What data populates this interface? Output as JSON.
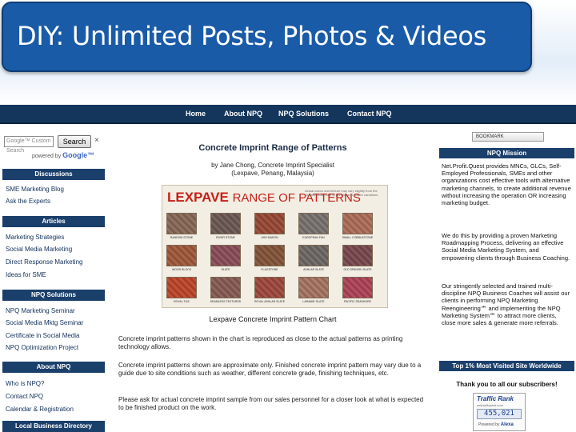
{
  "slide": {
    "title": "DIY: Unlimited Posts, Photos & Videos"
  },
  "topnav": {
    "items": [
      "Home",
      "About NPQ",
      "NPQ Solutions",
      "Contact NPQ"
    ]
  },
  "search": {
    "placeholder": "Google™ Custom Search",
    "button_label": "Search",
    "close": "×",
    "powered_by": "powered by",
    "powered_brand": "Google™"
  },
  "sidebar": {
    "sections": [
      {
        "heading": "Discussions",
        "links": [
          "SME Marketing Blog",
          "Ask the Experts"
        ]
      },
      {
        "heading": "Articles",
        "links": [
          "Marketing Strategies",
          "Social Media Marketing",
          "Direct Response Marketing",
          "Ideas for SME"
        ]
      },
      {
        "heading": "NPQ Solutions",
        "links": [
          "NPQ Marketing Seminar",
          "Social Media Mktg Seminar",
          "Certificate in Social Media",
          "NPQ Optimization Project"
        ]
      },
      {
        "heading": "About NPQ",
        "links": [
          "Who is NPQ?",
          "Contact NPQ",
          "Calendar & Registration"
        ]
      },
      {
        "heading": "Local Business Directory",
        "links": []
      }
    ]
  },
  "main": {
    "heading": "Concrete Imprint Range of Patterns",
    "byline_1": "by Jane Chong, Concrete Imprint Specialist",
    "byline_2": "(Lexpave, Penang, Malaysia)",
    "chart_brand": "LEXPAVE",
    "chart_brand_suffix": "RANGE OF PATTERNS",
    "chart_note": "Actual colour and texture may vary slightly from the images shown due to printing and screen variations.",
    "caption": "Lexpave Concrete Imprint Pattern Chart",
    "paragraphs": [
      "Concrete imprint patterns shown in the chart is reproduced as close to the actual patterns as printing technology allows.",
      "Concrete imprint patterns shown are approximate only. Finished concrete imprint pattern may vary due to a guide due to site conditions such as weather, different concrete grade, finishing techniques, etc.",
      "Please ask for actual concrete imprint sample from our sales personnel for a closer look at what is expected to be finished product on the work."
    ],
    "patterns": [
      {
        "name": "RANDOM STONE",
        "color": "#8a6a58"
      },
      {
        "name": "RIVER STONE",
        "color": "#6d5a55"
      },
      {
        "name": "ASH MASON",
        "color": "#9b4a36"
      },
      {
        "name": "EUROPEAN FAN",
        "color": "#7a7472"
      },
      {
        "name": "SMALL COBBLESTONE",
        "color": "#b06f5b"
      },
      {
        "name": "WOOD BLOCK",
        "color": "#a35a3c"
      },
      {
        "name": "SLATE",
        "color": "#8c4f5b"
      },
      {
        "name": "FLAGSTONE",
        "color": "#86563a"
      },
      {
        "name": "ASHLAR SLATE",
        "color": "#6f6a66"
      },
      {
        "name": "OLD SPANISH SLATE",
        "color": "#7b4a50"
      },
      {
        "name": "ROYAL TILE",
        "color": "#c0472b"
      },
      {
        "name": "SEAMLESS TEXTURED",
        "color": "#8a5d55"
      },
      {
        "name": "ROYAL ASHLAR SLATE",
        "color": "#a14a3f"
      },
      {
        "name": "LARAMIE SLATE",
        "color": "#a97665"
      },
      {
        "name": "PACIFIC SEASHORE",
        "color": "#b1445a"
      }
    ]
  },
  "rightbar": {
    "share_label": "BOOKMARK",
    "mission_heading": "NPQ Mission",
    "mission_paragraphs": [
      "Net.Profit.Quest provides MNCs, GLCs, Self-Employed Professionals, SMEs and other organizations cost effective tools with alternative marketing channels, to create additional revenue without increasing the operation OR increasing marketing budget.",
      "We do this by providing a proven Marketing Roadmapping Process, delivering an effective Social Media Marketing System, and empowering clients through Business Coaching.",
      "Our stringently selected and trained multi-discipline NPQ Business Coaches will assist our clients in performing NPQ Marketing Reengineering℠ and implementing the NPQ Marketing System℠ to attract more clients, close more sales & generate more referrals."
    ],
    "rank_heading": "Top 1% Most Visited Site Worldwide",
    "thanks": "Thank you to all our subscribers!",
    "traffic_label": "Traffic Rank",
    "traffic_sub": "netprofitquest.com",
    "rank_value": "455,021",
    "powered_by": "Powered by",
    "powered_brand": "Alexa"
  }
}
